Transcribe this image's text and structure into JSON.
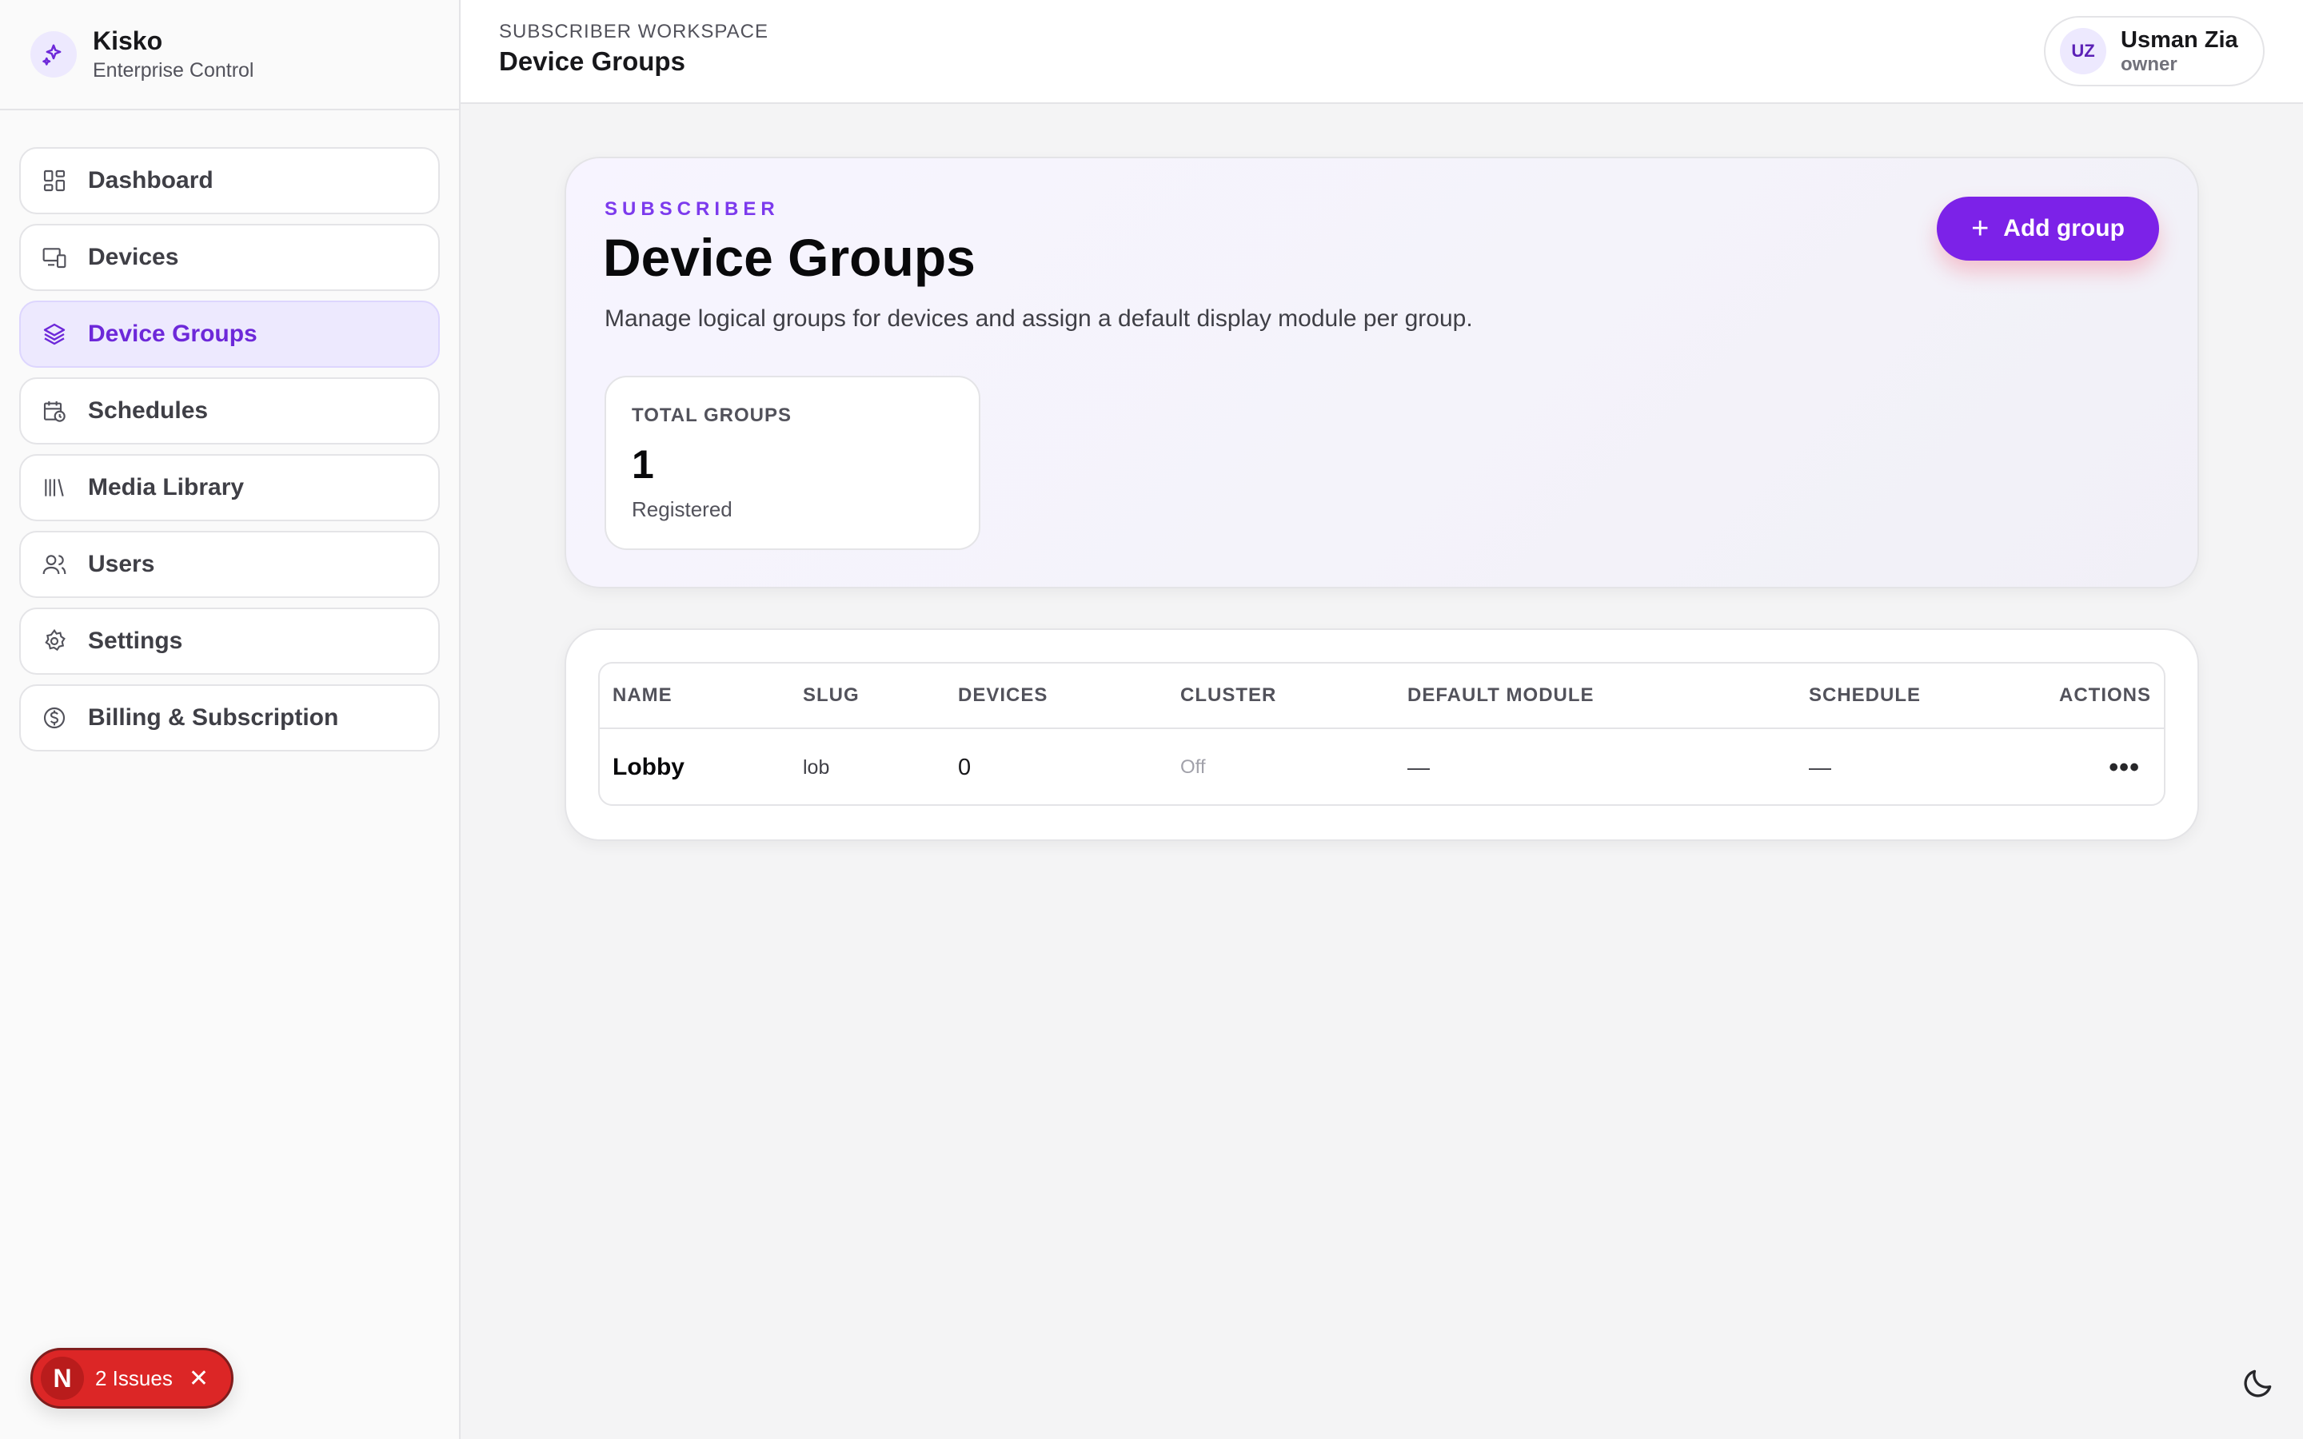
{
  "brand": {
    "name": "Kisko",
    "subtitle": "Enterprise Control"
  },
  "sidebar": {
    "items": [
      {
        "label": "Dashboard",
        "icon": "dashboard-grid-icon",
        "active": false
      },
      {
        "label": "Devices",
        "icon": "devices-icon",
        "active": false
      },
      {
        "label": "Device Groups",
        "icon": "layers-icon",
        "active": true
      },
      {
        "label": "Schedules",
        "icon": "calendar-clock-icon",
        "active": false
      },
      {
        "label": "Media Library",
        "icon": "library-icon",
        "active": false
      },
      {
        "label": "Users",
        "icon": "users-icon",
        "active": false
      },
      {
        "label": "Settings",
        "icon": "gear-icon",
        "active": false
      },
      {
        "label": "Billing & Subscription",
        "icon": "dollar-circle-icon",
        "active": false
      }
    ]
  },
  "header": {
    "breadcrumb": "SUBSCRIBER WORKSPACE",
    "title": "Device Groups",
    "user": {
      "initials": "UZ",
      "name": "Usman Zia",
      "role": "owner"
    }
  },
  "hero": {
    "eyebrow": "SUBSCRIBER",
    "title": "Device Groups",
    "description": "Manage logical groups for devices and assign a default display module per group.",
    "add_button": "Add group",
    "stat": {
      "label": "TOTAL GROUPS",
      "value": "1",
      "sub": "Registered"
    }
  },
  "table": {
    "columns": [
      "NAME",
      "SLUG",
      "DEVICES",
      "CLUSTER",
      "DEFAULT MODULE",
      "SCHEDULE",
      "ACTIONS"
    ],
    "rows": [
      {
        "name": "Lobby",
        "slug": "lob",
        "devices": "0",
        "cluster": "Off",
        "default_module": "—",
        "schedule": "—",
        "actions": "•••"
      }
    ]
  },
  "issues": {
    "badge": "N",
    "label": "2 Issues",
    "close": "✕"
  },
  "colors": {
    "accent": "#7c22e8",
    "active_bg": "#ede9fe",
    "danger": "#dc2626"
  }
}
